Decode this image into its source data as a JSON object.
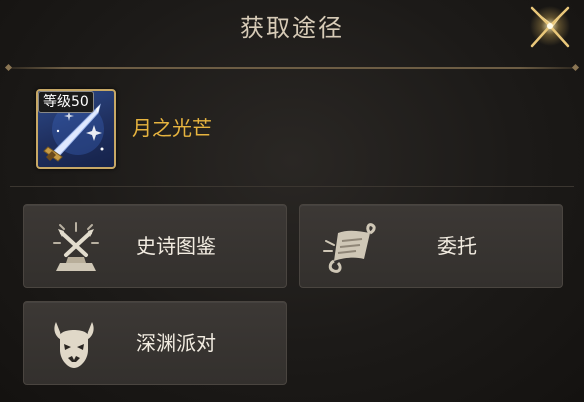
{
  "dialog": {
    "title": "获取途径",
    "close_icon": "close-star-icon"
  },
  "item": {
    "level_badge": "等级50",
    "name": "月之光芒",
    "icon": "sword-icon",
    "name_color": "#e7b43f"
  },
  "sources": [
    {
      "label": "史诗图鉴",
      "icon": "epic-codex-icon"
    },
    {
      "label": "委托",
      "icon": "commission-scroll-icon"
    },
    {
      "label": "深渊派对",
      "icon": "abyss-demon-icon"
    }
  ]
}
